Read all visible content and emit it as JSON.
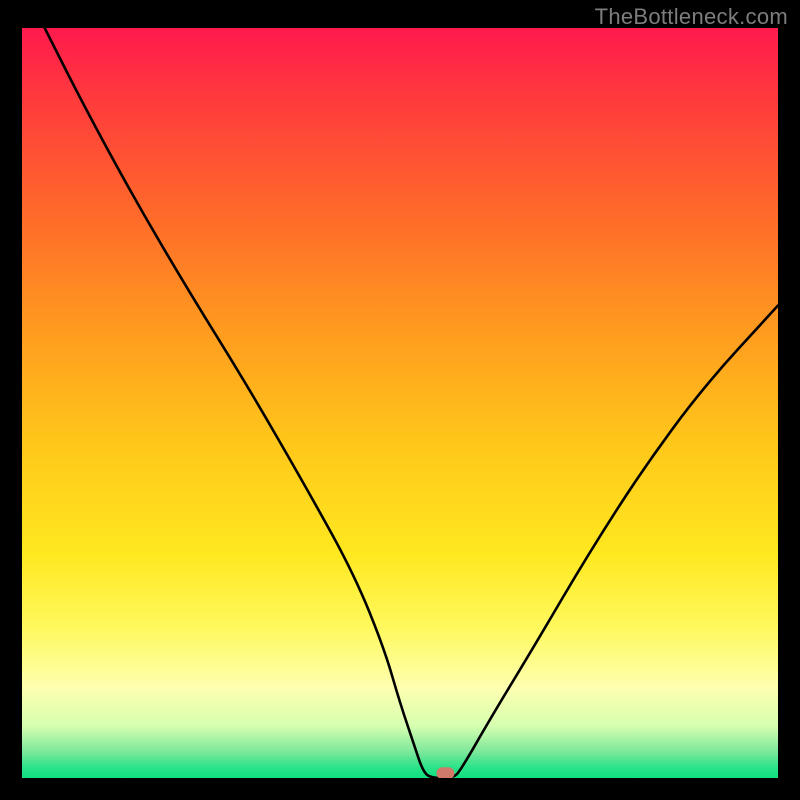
{
  "watermark": "TheBottleneck.com",
  "colors": {
    "background": "#000000",
    "gradient_top": "#ff1a4d",
    "gradient_bottom": "#0de080",
    "curve": "#000000",
    "marker": "#d07a6a"
  },
  "chart_data": {
    "type": "line",
    "title": "",
    "subtitle": "",
    "xlabel": "",
    "ylabel": "",
    "legend": [],
    "annotations": [],
    "xlim": [
      0,
      100
    ],
    "ylim": [
      0,
      100
    ],
    "grid": false,
    "series": [
      {
        "name": "bottleneck-curve",
        "x": [
          3,
          8,
          15,
          22,
          30,
          38,
          44,
          48,
          50,
          52,
          53,
          54,
          57,
          58,
          62,
          68,
          75,
          82,
          90,
          100
        ],
        "y": [
          100,
          90,
          77,
          65,
          52,
          38,
          27,
          17,
          10,
          4,
          1,
          0,
          0,
          1,
          8,
          18,
          30,
          41,
          52,
          63
        ]
      }
    ],
    "marker": {
      "x": 56,
      "y": 0.5,
      "shape": "rounded-rect"
    }
  }
}
